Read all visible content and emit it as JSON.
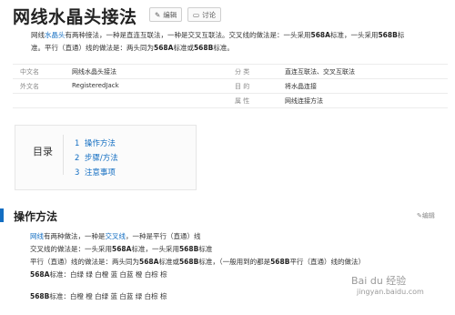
{
  "title": "网线水晶头接法",
  "buttons": {
    "edit": "编辑",
    "discuss": "讨论"
  },
  "intro": {
    "p1": "网线水晶头有两种接法，一种是直连互联法，一种是交叉互联法。交叉线的做法是：一头采用568A标准，一头采用568B标",
    "p2": "准。平行（直通）线的做法是：两头同为568A标准或568B标准。"
  },
  "info": [
    {
      "key": "中文名",
      "value": "网线水晶头接法"
    },
    {
      "key": "外文名",
      "value": "RegisteredJack"
    },
    {
      "key": "分    类",
      "value": "直连互联法、交叉互联法"
    },
    {
      "key": "目    的",
      "value": "将水晶连接"
    },
    {
      "key": "属    性",
      "value": "网线连接方法"
    }
  ],
  "toc": {
    "title": "目录",
    "items": [
      {
        "num": "1",
        "label": "操作方法"
      },
      {
        "num": "2",
        "label": "步骤/方法"
      },
      {
        "num": "3",
        "label": "注意事项"
      }
    ]
  },
  "section": {
    "title": "操作方法",
    "edit": "编辑"
  },
  "body": [
    "网线有两种做法，一种是交叉线，一种是平行（直通）线",
    "交叉线的做法是：一头采用568A标准，一头采用568B标准",
    "平行（直通）线的做法是：两头同为568A标准或568B标准，（一般用到的都是568B平行（直通）线的做法）",
    "568A标准：白绿 绿 白橙 蓝 白蓝 橙 白棕 棕",
    "568B标准：白橙 橙 白绿 蓝 白蓝 绿 白棕 棕"
  ],
  "watermark": {
    "line1": "Bai du 经验",
    "line2": "jingyan.baidu.com"
  },
  "colors": {
    "link": "#136ec2",
    "accent": "#136ec2"
  }
}
